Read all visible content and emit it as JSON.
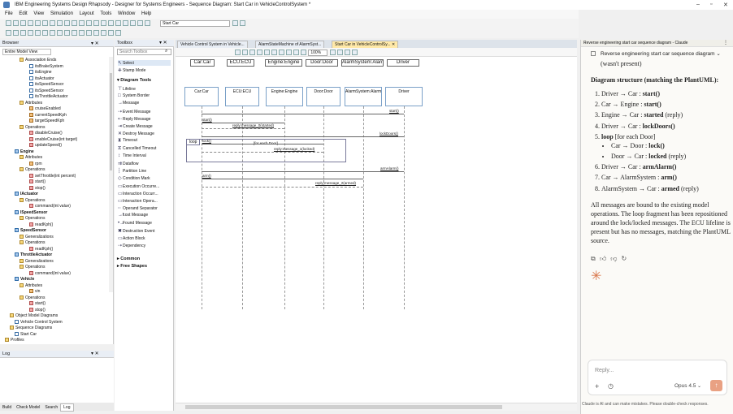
{
  "window": {
    "title": "IBM Engineering Systems Design Rhapsody - Designer for Systems Engineers - Sequence Diagram: Start Car in VehicleControlSystem *"
  },
  "menu": [
    "File",
    "Edit",
    "View",
    "Simulation",
    "Layout",
    "Tools",
    "Window",
    "Help"
  ],
  "toolbar": {
    "search_value": "Start Car"
  },
  "browser": {
    "title": "Browser",
    "view": "Entire Model View",
    "tree": [
      {
        "label": "Association Ends",
        "icon": "folder",
        "indent": 3
      },
      {
        "label": "itsBrakeSystem",
        "icon": "rel",
        "indent": 5
      },
      {
        "label": "itsEngine",
        "icon": "rel",
        "indent": 5
      },
      {
        "label": "itsActuator",
        "icon": "rel",
        "indent": 5
      },
      {
        "label": "itsSpeedSensor",
        "icon": "rel",
        "indent": 5
      },
      {
        "label": "itsSpeedSensor",
        "icon": "rel",
        "indent": 5
      },
      {
        "label": "itsThrottleActuator",
        "icon": "rel",
        "indent": 5
      },
      {
        "label": "Attributes",
        "icon": "folder",
        "indent": 3
      },
      {
        "label": "cruiseEnabled",
        "icon": "at",
        "indent": 5
      },
      {
        "label": "currentSpeedKph",
        "icon": "at",
        "indent": 5
      },
      {
        "label": "targetSpeedKph",
        "icon": "at",
        "indent": 5
      },
      {
        "label": "Operations",
        "icon": "folder",
        "indent": 3
      },
      {
        "label": "disableCruise()",
        "icon": "op",
        "indent": 5
      },
      {
        "label": "enableCruise(int target)",
        "icon": "op",
        "indent": 5
      },
      {
        "label": "updateSpeed()",
        "icon": "op",
        "indent": 5
      },
      {
        "label": "Engine",
        "icon": "cls",
        "indent": 2,
        "bold": true
      },
      {
        "label": "Attributes",
        "icon": "folder",
        "indent": 3
      },
      {
        "label": "rpm",
        "icon": "at",
        "indent": 5
      },
      {
        "label": "Operations",
        "icon": "folder",
        "indent": 3
      },
      {
        "label": "setThrottle(int percent)",
        "icon": "op",
        "indent": 5
      },
      {
        "label": "start()",
        "icon": "op",
        "indent": 5
      },
      {
        "label": "stop()",
        "icon": "op",
        "indent": 5
      },
      {
        "label": "IActuator",
        "icon": "cls",
        "indent": 2,
        "bold": true
      },
      {
        "label": "Operations",
        "icon": "folder",
        "indent": 3
      },
      {
        "label": "command(int value)",
        "icon": "op",
        "indent": 5
      },
      {
        "label": "ISpeedSensor",
        "icon": "cls",
        "indent": 2,
        "bold": true
      },
      {
        "label": "Operations",
        "icon": "folder",
        "indent": 3
      },
      {
        "label": "readKph()",
        "icon": "op",
        "indent": 5
      },
      {
        "label": "SpeedSensor",
        "icon": "cls",
        "indent": 2,
        "bold": true
      },
      {
        "label": "Generalizations",
        "icon": "folder",
        "indent": 3
      },
      {
        "label": "Operations",
        "icon": "folder",
        "indent": 3
      },
      {
        "label": "readKph()",
        "icon": "op",
        "indent": 5
      },
      {
        "label": "ThrottleActuator",
        "icon": "cls",
        "indent": 2,
        "bold": true
      },
      {
        "label": "Generalizations",
        "icon": "folder",
        "indent": 3
      },
      {
        "label": "Operations",
        "icon": "folder",
        "indent": 3
      },
      {
        "label": "command(int value)",
        "icon": "op",
        "indent": 5
      },
      {
        "label": "Vehicle",
        "icon": "cls",
        "indent": 2,
        "bold": true
      },
      {
        "label": "Attributes",
        "icon": "folder",
        "indent": 3
      },
      {
        "label": "vin",
        "icon": "at",
        "indent": 5
      },
      {
        "label": "Operations",
        "icon": "folder",
        "indent": 3
      },
      {
        "label": "start()",
        "icon": "op",
        "indent": 5
      },
      {
        "label": "stop()",
        "icon": "op",
        "indent": 5
      },
      {
        "label": "Object Model Diagrams",
        "icon": "folder",
        "indent": 1
      },
      {
        "label": "Vehicle Control System",
        "icon": "rel",
        "indent": 2
      },
      {
        "label": "Sequence Diagrams",
        "icon": "folder",
        "indent": 1
      },
      {
        "label": "Start Car",
        "icon": "rel",
        "indent": 2
      },
      {
        "label": "Profiles",
        "icon": "folder",
        "indent": 0
      }
    ]
  },
  "log": {
    "title": "Log",
    "tabs": [
      "Build",
      "Check Model",
      "Search",
      "Log"
    ],
    "active_tab": "Log"
  },
  "toolbox": {
    "title": "Toolbox",
    "search_placeholder": "Search Toolbox",
    "top_items": [
      "Select",
      "Stamp Mode"
    ],
    "section": "Diagram Tools",
    "items": [
      "Lifeline",
      "System Border",
      "Message",
      "Event Message",
      "Reply Message",
      "Create Message",
      "Destroy Message",
      "Timeout",
      "Cancelled Timeout",
      "Time Interval",
      "Dataflow",
      "Partition Line",
      "Condition Mark",
      "Execution Occurre...",
      "Interaction Occurr...",
      "Interaction Opera...",
      "Operand Separator",
      "Lost Message",
      "Found Message",
      "Destruction Event",
      "Action Block",
      "Dependency"
    ],
    "groups": [
      "Common",
      "Free Shapes"
    ]
  },
  "doc_tabs": [
    {
      "label": "Vehicle Control System in Vehicle...",
      "active": false
    },
    {
      "label": "AlarmStateMachine of AlarmSyst...",
      "active": false
    },
    {
      "label": "Start Car in VehicleControlSy...",
      "active": true
    }
  ],
  "diagram": {
    "zoom": "100%",
    "header_labels": [
      "Car:Car",
      "ECU:ECU",
      "Engine:Engine",
      "Door:Door",
      "AlarmSystem:AlarmSystem",
      "Driver"
    ],
    "lifelines": [
      "Car:Car",
      "ECU:ECU",
      "Engine:Engine",
      "Door:Door",
      "AlarmSystem:AlarmSystem",
      "Driver"
    ],
    "messages": [
      "start()",
      "start()",
      "reply:message_0(started)",
      "lockDoors()",
      "lock()",
      "reply:message_1(locked)",
      "armAlarm()",
      "arm()",
      "reply:message_2(armed)"
    ],
    "loop_label": "loop",
    "loop_condition": "[for each Door]"
  },
  "claude": {
    "header": "Reverse engineering start car sequence diagram - Claude",
    "task_title": "Reverse engineering start car sequence diagram",
    "wasnt": "(wasn't present)",
    "structure_title": "Diagram structure (matching the PlantUML):",
    "steps": [
      {
        "pre": "Driver → Car : ",
        "bold": "start()",
        "post": ""
      },
      {
        "pre": "Car → Engine : ",
        "bold": "start()",
        "post": ""
      },
      {
        "pre": "Engine → Car : ",
        "bold": "started",
        "post": " (reply)"
      },
      {
        "pre": "Driver → Car : ",
        "bold": "lockDoors()",
        "post": ""
      },
      {
        "pre": "",
        "bold": "loop",
        "post": " [for each Door]"
      },
      {
        "pre": "Car → Door : ",
        "bold": "lock()",
        "post": ""
      },
      {
        "pre": "Door → Car : ",
        "bold": "locked",
        "post": " (reply)"
      },
      {
        "pre": "Driver → Car : ",
        "bold": "armAlarm()",
        "post": ""
      },
      {
        "pre": "Car → AlarmSystem : ",
        "bold": "arm()",
        "post": ""
      },
      {
        "pre": "AlarmSystem → Car : ",
        "bold": "armed",
        "post": " (reply)"
      }
    ],
    "summary": "All messages are bound to the existing model operations. The loop fragment has been repositioned around the lock/locked messages. The ECU lifeline is present but has no messages, matching the PlantUML source.",
    "reply_placeholder": "Reply...",
    "model": "Opus 4.5",
    "disclaimer": "Claude is AI and can make mistakes. Please double-check responses."
  }
}
